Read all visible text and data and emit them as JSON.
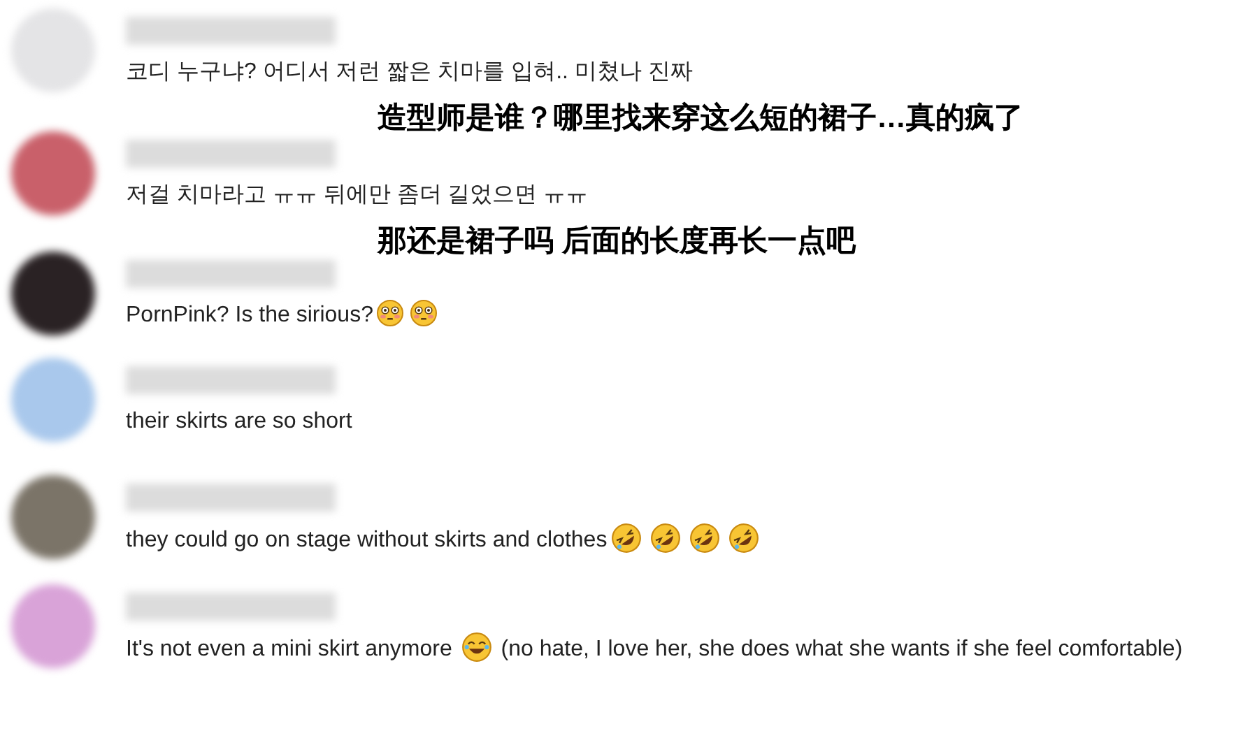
{
  "comments": [
    {
      "color": "#e4e4e6",
      "parts": [
        {
          "kind": "text",
          "text": "코디 누구냐? 어디서 저런 짧은 치마를 입혀.. 미쳤나 진짜"
        }
      ],
      "translation": "造型师是谁？哪里找来穿这么短的裙子…真的疯了"
    },
    {
      "color": "#c9606a",
      "parts": [
        {
          "kind": "text",
          "text": "저걸 치마라고 ㅠㅠ 뒤에만 좀더 길었으면 ㅠㅠ"
        }
      ],
      "translation": "那还是裙子吗 后面的长度再长一点吧"
    },
    {
      "color": "#2a2224",
      "parts": [
        {
          "kind": "text",
          "text": "PornPink? Is the sirious?"
        },
        {
          "kind": "flushed"
        },
        {
          "kind": "flushed"
        }
      ]
    },
    {
      "color": "#a9c8ec",
      "parts": [
        {
          "kind": "text",
          "text": "their skirts are so short"
        }
      ]
    },
    {
      "color": "#7b7468",
      "parts": [
        {
          "kind": "text",
          "text": "they could go on stage without skirts and clothes"
        },
        {
          "kind": "rofl"
        },
        {
          "kind": "rofl"
        },
        {
          "kind": "rofl"
        },
        {
          "kind": "rofl"
        }
      ]
    },
    {
      "color": "#d9a3d8",
      "parts": [
        {
          "kind": "text",
          "text": "It's not even a mini skirt anymore "
        },
        {
          "kind": "joy"
        },
        {
          "kind": "text",
          "text": " (no hate, I love her, she does what she wants if she feel comfortable)"
        }
      ]
    }
  ]
}
